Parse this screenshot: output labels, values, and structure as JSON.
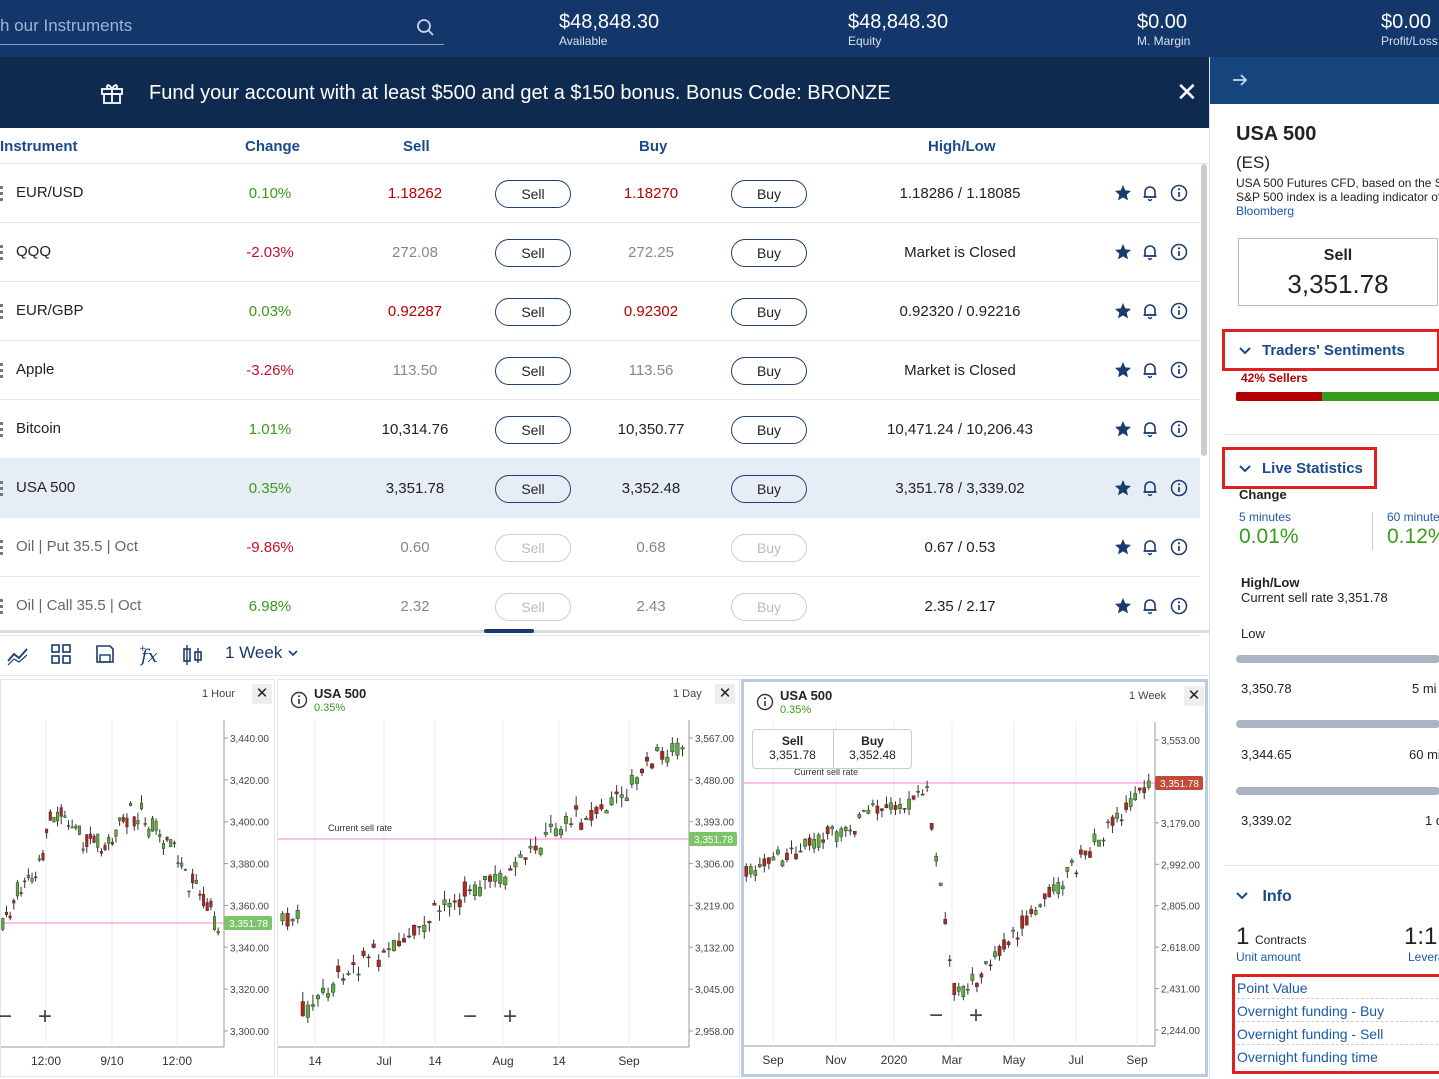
{
  "topbar": {
    "search_placeholder": "h our Instruments",
    "stats": [
      {
        "value": "$48,848.30",
        "label": "Available"
      },
      {
        "value": "$48,848.30",
        "label": "Equity"
      },
      {
        "value": "$0.00",
        "label": "M. Margin"
      },
      {
        "value": "$0.00",
        "label": "Profit/Loss"
      }
    ]
  },
  "banner": {
    "text": "Fund your account with at least $500 and get a $150 bonus. Bonus Code: BRONZE",
    "close": "✕"
  },
  "table": {
    "headers": {
      "instrument": "Instrument",
      "change": "Change",
      "sell": "Sell",
      "buy": "Buy",
      "highlow": "High/Low"
    },
    "rows": [
      {
        "name": "EUR/USD",
        "change": "0.10%",
        "sell": "1.18262",
        "sell_btn": "Sell",
        "buy": "1.18270",
        "buy_btn": "Buy",
        "highlow": "1.18286 / 1.18085"
      },
      {
        "name": "QQQ",
        "change": "-2.03%",
        "sell": "272.08",
        "sell_btn": "Sell",
        "buy": "272.25",
        "buy_btn": "Buy",
        "highlow": "Market is Closed"
      },
      {
        "name": "EUR/GBP",
        "change": "0.03%",
        "sell": "0.92287",
        "sell_btn": "Sell",
        "buy": "0.92302",
        "buy_btn": "Buy",
        "highlow": "0.92320 / 0.92216"
      },
      {
        "name": "Apple",
        "change": "-3.26%",
        "sell": "113.50",
        "sell_btn": "Sell",
        "buy": "113.56",
        "buy_btn": "Buy",
        "highlow": "Market is Closed"
      },
      {
        "name": "Bitcoin",
        "change": "1.01%",
        "sell": "10,314.76",
        "sell_btn": "Sell",
        "buy": "10,350.77",
        "buy_btn": "Buy",
        "highlow": "10,471.24 / 10,206.43"
      },
      {
        "name": "USA 500",
        "change": "0.35%",
        "sell": "3,351.78",
        "sell_btn": "Sell",
        "buy": "3,352.48",
        "buy_btn": "Buy",
        "highlow": "3,351.78 / 3,339.02"
      },
      {
        "name": "Oil | Put 35.5 | Oct",
        "change": "-9.86%",
        "sell": "0.60",
        "sell_btn": "Sell",
        "buy": "0.68",
        "buy_btn": "Buy",
        "highlow": "0.67 / 0.53"
      },
      {
        "name": "Oil | Call 35.5 | Oct",
        "change": "6.98%",
        "sell": "2.32",
        "sell_btn": "Sell",
        "buy": "2.43",
        "buy_btn": "Buy",
        "highlow": "2.35 / 2.17"
      }
    ]
  },
  "toolbar": {
    "timeframe": "1 Week"
  },
  "charts": [
    {
      "interval": "1 Hour",
      "price_tag": "3,351.78",
      "y_ticks": [
        "3,440.00",
        "3,420.00",
        "3,400.00",
        "3,380.00",
        "3,360.00",
        "3,340.00",
        "3,320.00",
        "3,300.00"
      ],
      "x_ticks": [
        "12:00",
        "9/10",
        "12:00"
      ]
    },
    {
      "title": "USA 500",
      "change": "0.35%",
      "interval": "1 Day",
      "price_tag": "3,351.78",
      "sell_rate_label": "Current sell rate",
      "y_ticks": [
        "3,567.00",
        "3,480.00",
        "3,393.00",
        "3,306.00",
        "3,219.00",
        "3,132.00",
        "3,045.00",
        "2,958.00"
      ],
      "x_ticks": [
        "14",
        "Jul",
        "14",
        "Aug",
        "14",
        "Sep"
      ]
    },
    {
      "title": "USA 500",
      "change": "0.35%",
      "interval": "1 Week",
      "price_tag": "3,351.78",
      "sell_rate_label": "Current sell rate",
      "sell_label": "Sell",
      "sell_value": "3,351.78",
      "buy_label": "Buy",
      "buy_value": "3,352.48",
      "y_ticks": [
        "3,553.00",
        "3,366.00",
        "3,179.00",
        "2,992.00",
        "2,805.00",
        "2,618.00",
        "2,431.00",
        "2,244.00"
      ],
      "x_ticks": [
        "Sep",
        "Nov",
        "2020",
        "Mar",
        "May",
        "Jul",
        "Sep"
      ]
    }
  ],
  "sidebar": {
    "title": "USA 500",
    "symbol": "(ES)",
    "desc1": "USA 500 Futures CFD, based on the S&",
    "desc2": "S&P 500 index is a leading indicator of",
    "source": "Bloomberg",
    "sell_label": "Sell",
    "sell_value": "3,351.78",
    "sentiments_title": "Traders' Sentiments",
    "sellers_text": "42% Sellers",
    "sellers_pct": 0.42,
    "live_title": "Live Statistics",
    "change_label": "Change",
    "m5_label": "5 minutes",
    "m5_value": "0.01%",
    "m60_label": "60 minute",
    "m60_value": "0.12%",
    "highlow_label": "High/Low",
    "current_rate": "Current sell rate 3,351.78",
    "low_label": "Low",
    "low1": "3,350.78",
    "low1_right": "5 mi",
    "low2": "3,344.65",
    "low2_right": "60 mi",
    "low3": "3,339.02",
    "low3_right": "1 d",
    "info_title": "Info",
    "contracts_num": "1",
    "contracts_label": "Contracts",
    "unit_amount": "Unit amount",
    "leverage_value": "1:1",
    "leverage_label": "Levera",
    "info_links": [
      "Point Value",
      "Overnight funding - Buy",
      "Overnight funding - Sell",
      "Overnight funding time"
    ]
  },
  "colors": {
    "navy": "#13366b",
    "green": "#3a9a1a",
    "red": "#c8102e",
    "highlight": "#e02020"
  }
}
